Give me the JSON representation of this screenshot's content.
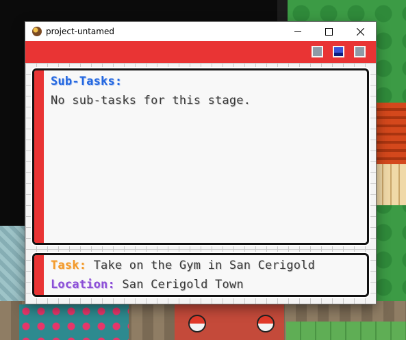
{
  "window": {
    "title": "project-untamed",
    "icon": "pokeball-app-icon"
  },
  "toolbar": {
    "buttons": [
      "gray-square-button",
      "blue-square-button",
      "gray-square-button"
    ],
    "accent_color": "#e93434"
  },
  "subtasks": {
    "heading": "Sub-Tasks:",
    "empty_message": "No sub-tasks for this stage."
  },
  "quest": {
    "task_label": "Task:",
    "task_value": "Take on the Gym in San Cerigold",
    "location_label": "Location:",
    "location_value": "San Cerigold Town"
  },
  "colors": {
    "heading_blue": "#2468e0",
    "task_orange": "#f39a2b",
    "location_purple": "#8b4fd6",
    "panel_accent_red": "#e93434"
  }
}
